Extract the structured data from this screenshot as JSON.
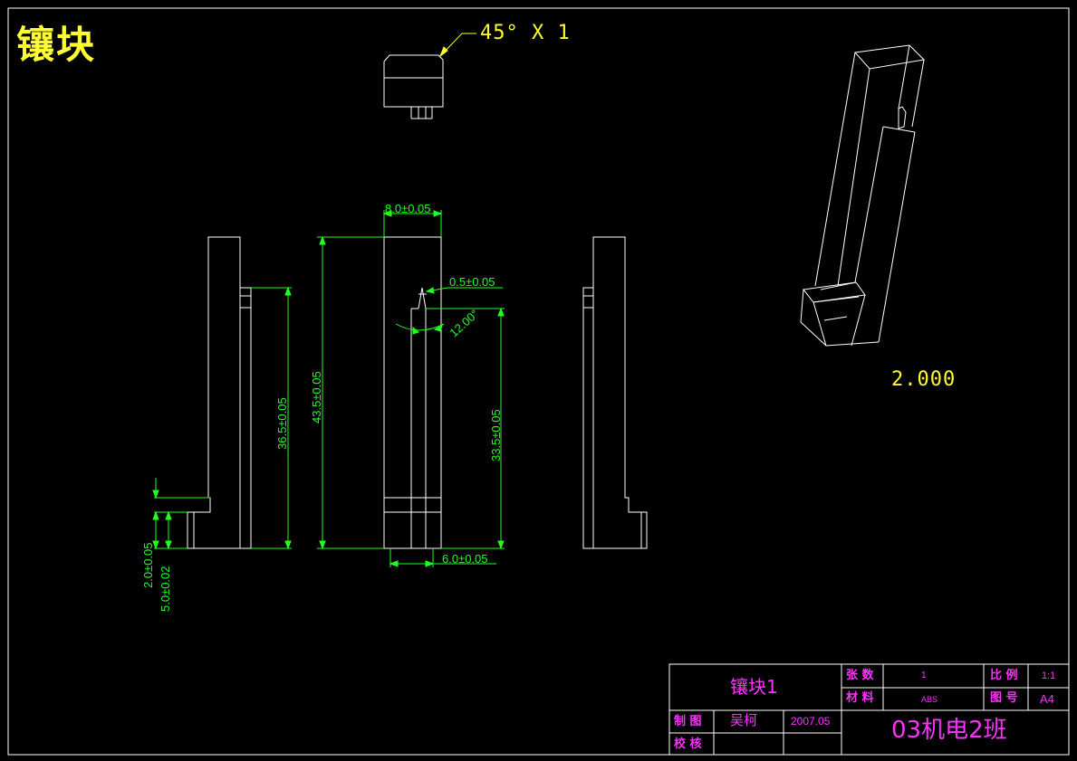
{
  "drawing_title": "镶块",
  "chamfer_note": "45° X 1",
  "scale_note": "2.000",
  "dimensions": {
    "top_width": "8.0±0.05",
    "total_height": "43.5±0.05",
    "left_height": "36.5±0.05",
    "right_height": "33.5±0.05",
    "slot_width": "0.5±0.05",
    "angle": "12.00°",
    "bottom_width": "6.0±0.05",
    "step_small": "2.0±0.05",
    "step_large": "5.0±0.02"
  },
  "title_block": {
    "part_name": "镶块1",
    "sheets_label": "张 数",
    "sheets_value": "1",
    "scale_label": "比 例",
    "scale_value": "1:1",
    "material_label": "材 料",
    "material_value": "ABS",
    "drawing_no_label": "图 号",
    "drawing_no_value": "A4",
    "drawn_label": "制 图",
    "drawn_by": "吴柯",
    "date": "2007.05",
    "checked_label": "校 核",
    "class_name": "03机电2班"
  },
  "colors": {
    "background": "#000000",
    "outline": "#ffffff",
    "dimension": "#22ff22",
    "title_block": "#ff33ff",
    "note_text": "#ffff33"
  }
}
